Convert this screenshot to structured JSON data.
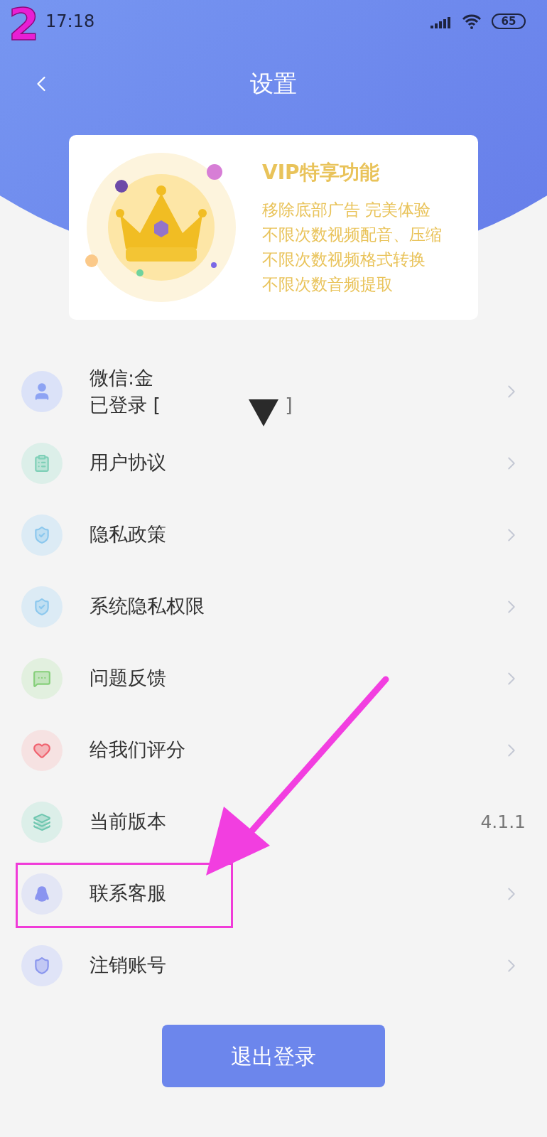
{
  "annotation_step": "2",
  "status_bar": {
    "time": "17:18",
    "battery": "65"
  },
  "header": {
    "title": "设置"
  },
  "vip_card": {
    "title": "VIP特享功能",
    "features": [
      "移除底部广告 完美体验",
      "不限次数视频配音、压缩",
      "不限次数视频格式转换",
      "不限次数音频提取"
    ]
  },
  "account": {
    "line_1": "微信:金",
    "line_2_start": "已登录 [",
    "line_2_end": "]"
  },
  "menu_items": [
    {
      "label": "用户协议",
      "kind": "link",
      "highlighted": false
    },
    {
      "label": "隐私政策",
      "kind": "link",
      "highlighted": false
    },
    {
      "label": "系统隐私权限",
      "kind": "link",
      "highlighted": false
    },
    {
      "label": "问题反馈",
      "kind": "link",
      "highlighted": false
    },
    {
      "label": "给我们评分",
      "kind": "link",
      "highlighted": false
    },
    {
      "label": "当前版本",
      "kind": "value",
      "value": "4.1.1",
      "highlighted": false
    },
    {
      "label": "联系客服",
      "kind": "link",
      "highlighted": true
    },
    {
      "label": "注销账号",
      "kind": "link",
      "highlighted": false
    }
  ],
  "logout_button": "退出登录"
}
